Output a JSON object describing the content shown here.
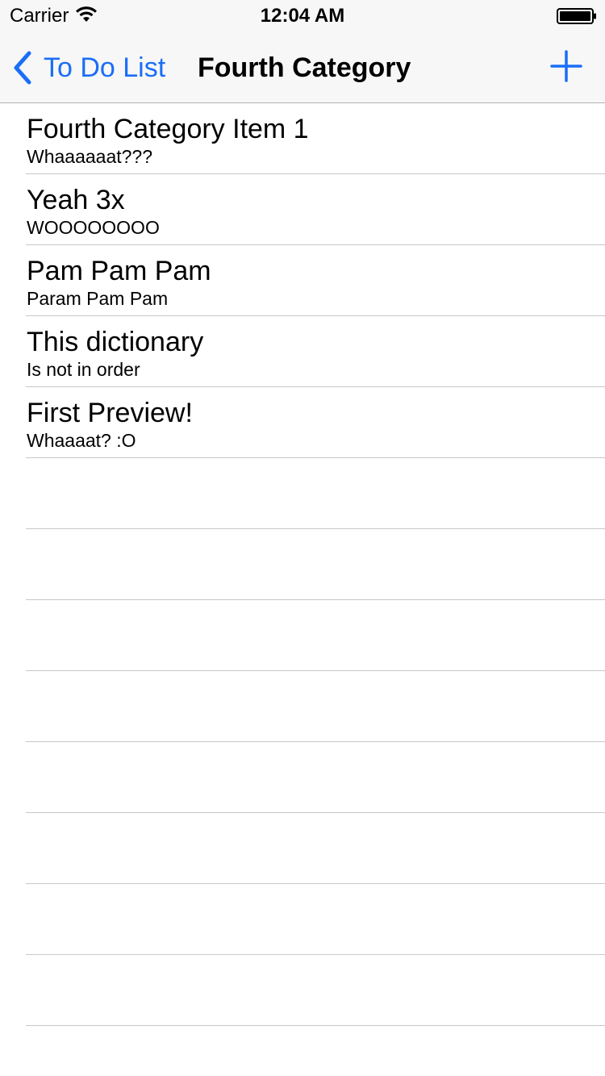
{
  "status_bar": {
    "carrier": "Carrier",
    "time": "12:04 AM",
    "icons": [
      "wifi-icon",
      "battery-icon"
    ]
  },
  "nav": {
    "back_label": "To Do List",
    "title": "Fourth Category",
    "icons": [
      "chevron-left-icon",
      "plus-icon"
    ],
    "accent_color": "#1a6ef7"
  },
  "items": [
    {
      "title": "Fourth Category Item 1",
      "subtitle": "Whaaaaaat???"
    },
    {
      "title": "Yeah 3x",
      "subtitle": "WOOOOOOOO"
    },
    {
      "title": "Pam Pam Pam",
      "subtitle": "Param Pam Pam"
    },
    {
      "title": "This dictionary",
      "subtitle": "Is not in order"
    },
    {
      "title": "First Preview!",
      "subtitle": "Whaaaat? :O"
    }
  ]
}
